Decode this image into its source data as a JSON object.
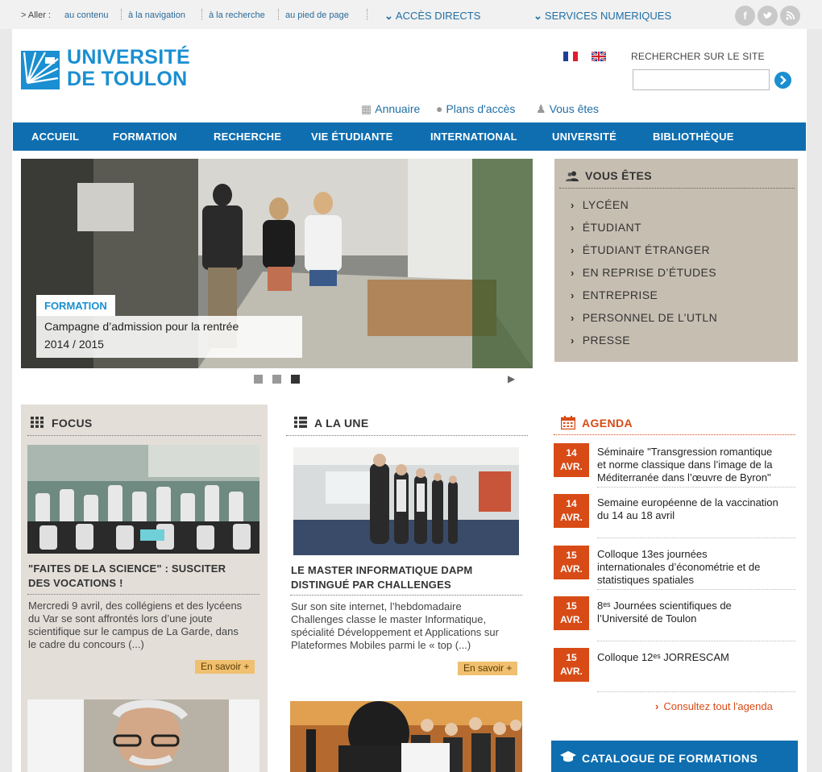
{
  "topbar": {
    "go_label": "> Aller :",
    "skip_links": [
      "au contenu",
      "à la navigation",
      "à la recherche",
      "au pied de page"
    ],
    "acces_directs": "ACCÈS DIRECTS",
    "services_numeriques": "SERVICES NUMERIQUES",
    "social_icons": [
      "facebook-icon",
      "twitter-icon",
      "rss-icon"
    ]
  },
  "header": {
    "logo_line1": "UNIVERSITÉ",
    "logo_line2": "DE TOULON",
    "search_label": "RECHERCHER SUR LE SITE",
    "search_value": "",
    "quick_links": [
      "Annuaire",
      "Plans d'accès",
      "Vous êtes"
    ]
  },
  "nav": {
    "items": [
      "ACCUEIL",
      "FORMATION",
      "RECHERCHE",
      "VIE ÉTUDIANTE",
      "INTERNATIONAL",
      "UNIVERSITÉ",
      "BIBLIOTHÈQUE"
    ]
  },
  "slider": {
    "tag": "FORMATION",
    "caption_line1": "Campagne d’admission pour la rentrée",
    "caption_line2": "2014 / 2015",
    "active_dot": 3,
    "dot_count": 3
  },
  "vous_etes": {
    "title": "VOUS ÊTES",
    "items": [
      "LYCÉEN",
      "ÉTUDIANT",
      "ÉTUDIANT ÉTRANGER",
      "EN REPRISE D’ÉTUDES",
      "ENTREPRISE",
      "PERSONNEL DE L’UTLN",
      "PRESSE"
    ]
  },
  "focus": {
    "title": "FOCUS",
    "article_title_line1": "\"FAITES DE LA SCIENCE\" : SUSCITER",
    "article_title_line2": "DES VOCATIONS !",
    "text_lines": [
      "Mercredi 9 avril, des collégiens et des lycéens",
      "du Var se sont affrontés lors d’une joute",
      "scientifique sur le campus de La Garde, dans",
      "le cadre du concours (...)"
    ],
    "more": "En savoir +"
  },
  "une": {
    "title": "A LA UNE",
    "article_title_line1": "LE MASTER INFORMATIQUE DAPM",
    "article_title_line2": "DISTINGUÉ PAR CHALLENGES",
    "text_lines": [
      "Sur son site internet, l’hebdomadaire",
      "Challenges classe le master Informatique,",
      "spécialité Développement et Applications sur",
      "Plateformes Mobiles parmi le « top (...)"
    ],
    "more": "En savoir +"
  },
  "agenda": {
    "title": "AGENDA",
    "events": [
      {
        "day": "14",
        "month": "AVR.",
        "lines": [
          "Séminaire \"Transgression romantique",
          "et norme classique dans l’image de la",
          "Méditerranée dans l’œuvre de Byron\""
        ]
      },
      {
        "day": "14",
        "month": "AVR.",
        "lines": [
          "Semaine européenne de la vaccination",
          "du 14 au 18 avril"
        ]
      },
      {
        "day": "15",
        "month": "AVR.",
        "lines": [
          "Colloque 13es journées",
          "internationales d’économétrie et de",
          "statistiques spatiales"
        ]
      },
      {
        "day": "15",
        "month": "AVR.",
        "lines": [
          "8ᵉˢ Journées scientifiques de",
          "l’Université de Toulon"
        ]
      },
      {
        "day": "15",
        "month": "AVR.",
        "lines": [
          "Colloque 12ᵉˢ JORRESCAM"
        ]
      }
    ],
    "all_link": "Consultez tout l'agenda"
  },
  "catalogue": {
    "label": "CATALOGUE DE FORMATIONS"
  },
  "colors": {
    "brand_blue": "#1a8fd1",
    "nav_blue": "#0e6eb0",
    "agenda_orange": "#d84b16",
    "vous_etes_bg": "#c7beb2",
    "focus_bg": "#e3ded8",
    "more_button": "#f0c070"
  }
}
